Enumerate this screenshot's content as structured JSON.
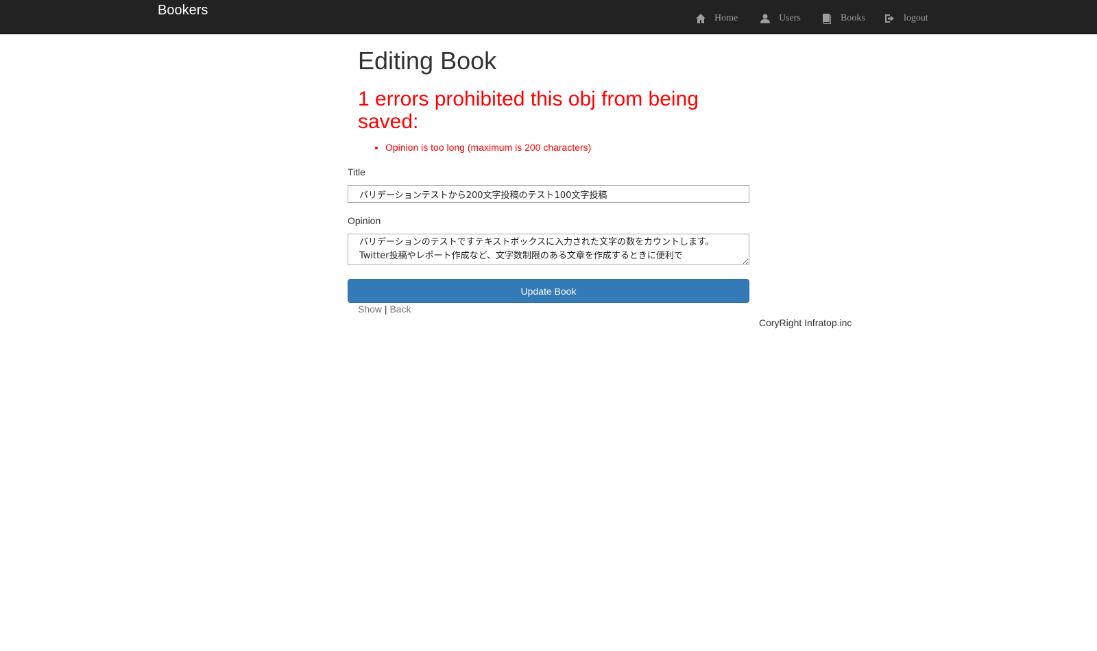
{
  "navbar": {
    "brand": "Bookers",
    "items": [
      {
        "label": "Home",
        "icon": "home-icon"
      },
      {
        "label": "Users",
        "icon": "user-icon"
      },
      {
        "label": "Books",
        "icon": "book-icon"
      },
      {
        "label": "logout",
        "icon": "logout-icon"
      }
    ]
  },
  "page": {
    "title": "Editing Book"
  },
  "errors": {
    "heading": "1 errors prohibited this obj from being saved:",
    "messages": [
      "Opinion is too long (maximum is 200 characters)"
    ]
  },
  "form": {
    "title_label": "Title",
    "title_value": "バリデーションテストから200文字投稿のテスト100文字投稿",
    "opinion_label": "Opinion",
    "opinion_value": "バリデーションのテストですテキストボックスに入力された文字の数をカウントします。 Twitter投稿やレポート作成など、文字数制限のある文章を作成するときに便利で",
    "submit_label": "Update Book"
  },
  "links": {
    "show": "Show",
    "separator": "|",
    "back": "Back"
  },
  "footer": {
    "text": "CoryRight Infratop.inc"
  },
  "colors": {
    "navbar_bg": "#222222",
    "error": "#ff0000",
    "primary_button": "#337ab7"
  }
}
